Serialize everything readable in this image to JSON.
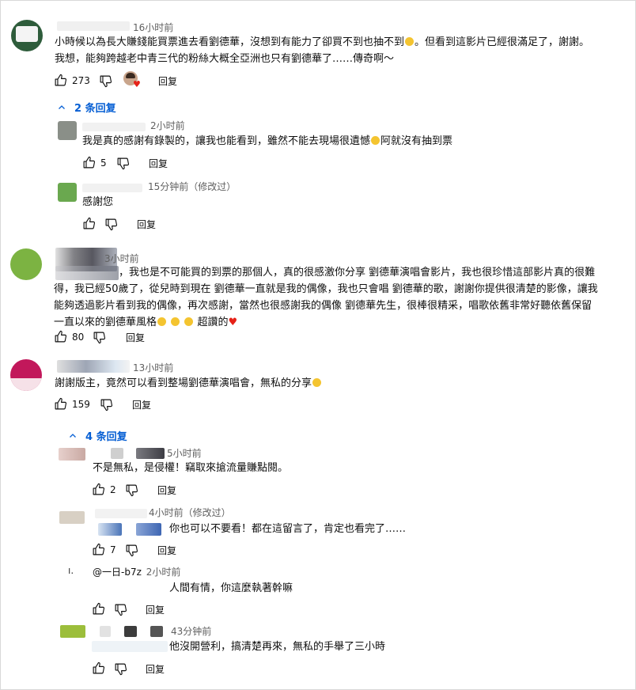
{
  "comments": [
    {
      "time": "16小时前",
      "text1": "小時候以為長大賺錢能買票進去看劉德華，沒想到有能力了卻買不到也抽不到",
      "text1b": "。但看到這影片已經很滿足了，謝謝。",
      "text2": "我想，能夠跨越老中青三代的粉絲大概全亞洲也只有劉德華了……傳奇啊～",
      "likes": "273",
      "reply": "回复",
      "replies_toggle": "2 条回复",
      "replies": [
        {
          "time": "2小时前",
          "text": "我是真的感謝有錄製的，讓我也能看到，雖然不能去現場很遺憾",
          "text_b": "阿就沒有抽到票",
          "likes": "5",
          "reply": "回复"
        },
        {
          "time": "15分钟前（修改过）",
          "text": "感謝您",
          "likes": "",
          "reply": "回复"
        }
      ]
    },
    {
      "time": "3小时前",
      "text1": "，我也是不可能買的到票的那個人，真的很感激你分享 劉德華演唱會影片，我也很珍惜這部影片真的很難",
      "text2": "得，我已經50歲了，從兒時到現在 劉德華一直就是我的偶像，我也只會唱 劉德華的歌，謝謝你提供很清楚的影像，讓我",
      "text3": "能夠透過影片看到我的偶像，再次感謝，當然也很感謝我的偶像 劉德華先生，很棒很精采，唱歌依舊非常好聽依舊保留",
      "text4": "一直以來的劉德華風格",
      "text4b": "超讚的",
      "likes": "80",
      "reply": "回复"
    },
    {
      "time": "13小时前",
      "text": "謝謝版主，竟然可以看到整場劉德華演唱會，無私的分享",
      "likes": "159",
      "reply": "回复",
      "replies_toggle": "4 条回复",
      "replies": [
        {
          "time": "5小时前",
          "text": "不是無私，是侵權！竊取來搶流量賺點閱。",
          "likes": "2",
          "reply": "回复"
        },
        {
          "time": "4小时前（修改过）",
          "text": "你也可以不要看！都在這留言了，肯定也看完了……",
          "likes": "7",
          "reply": "回复"
        },
        {
          "handle": "@一日-b7z",
          "time": "2小时前",
          "text": "人間有情，你這麼執著幹嘛",
          "likes": "",
          "reply": "回复"
        },
        {
          "time": "43分钟前",
          "text": "他沒開營利，搞清楚再來，無私的手舉了三小時",
          "likes": "",
          "reply": "回复"
        }
      ]
    }
  ],
  "icons": [
    "thumb-up-icon",
    "thumb-down-icon",
    "chevron-up-icon",
    "heart-icon",
    "emoji-icon"
  ],
  "colors": {
    "link": "#065fd4",
    "heart": "#e62117",
    "meta": "#606060"
  }
}
